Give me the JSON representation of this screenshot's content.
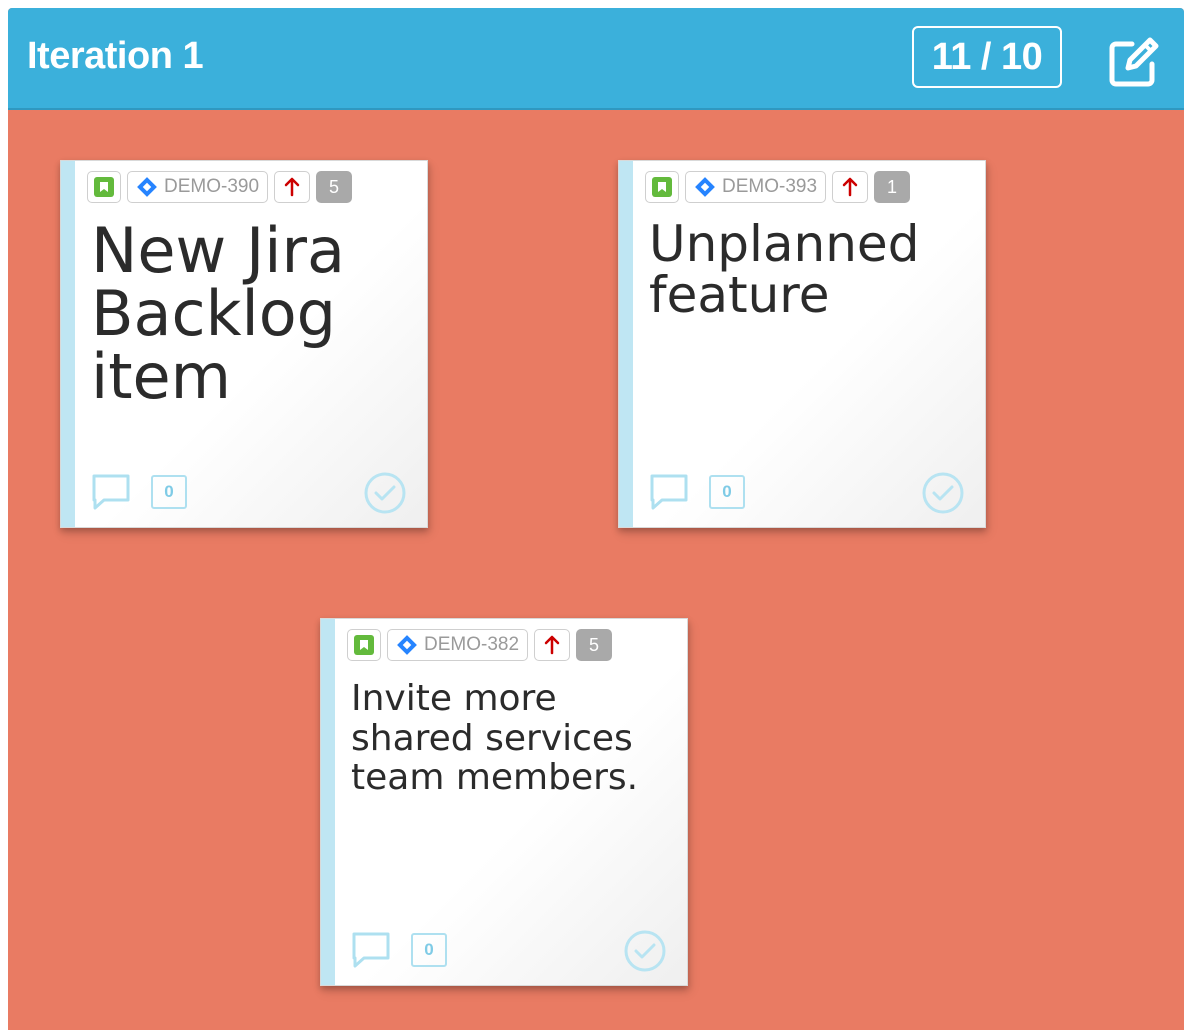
{
  "header": {
    "title": "Iteration 1",
    "count": "11 / 10",
    "edit_icon": "edit-icon"
  },
  "colors": {
    "header_bg": "#3bb0db",
    "board_bg": "#e97b63",
    "card_stripe": "#bfe6f3",
    "story_type": "#63ba3c",
    "jira_blue": "#2684ff",
    "priority_red": "#cc0000",
    "points_badge": "#a9a9a9"
  },
  "cards": [
    {
      "issue_type_icon": "story-icon",
      "key": "DEMO-390",
      "priority_icon": "priority-high-arrow-icon",
      "points": "5",
      "title": "New Jira Backlog item",
      "comments": "0"
    },
    {
      "issue_type_icon": "story-icon",
      "key": "DEMO-393",
      "priority_icon": "priority-high-arrow-icon",
      "points": "1",
      "title": "Unplanned feature",
      "comments": "0"
    },
    {
      "issue_type_icon": "story-icon",
      "key": "DEMO-382",
      "priority_icon": "priority-high-arrow-icon",
      "points": "5",
      "title": "Invite more shared services team members.",
      "comments": "0"
    }
  ]
}
